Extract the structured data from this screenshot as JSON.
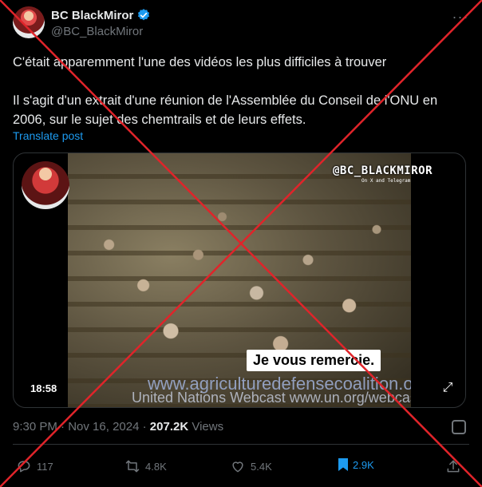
{
  "author": {
    "name": "BC BlackMiror",
    "handle": "@BC_BlackMiror",
    "verified_icon": "verified-badge-icon"
  },
  "more_icon": "more-options-icon",
  "tweet": {
    "line1": "C'était apparemment l'une des vidéos les plus difficiles à trouver",
    "line2": "Il s'agit d'un extrait d'une réunion de l'Assemblée du Conseil de l'ONU en 2006, sur le sujet des chemtrails et de leurs effets.",
    "translate_label": "Translate post"
  },
  "media": {
    "watermark": "@BC_BLACKMIROR",
    "watermark_sub": "On X and Telegram",
    "subtitle": "Je vous remercie.",
    "url_text": "www.agriculturedefensecoalition.org",
    "webcast_text": "United Nations Webcast www.un.org/webcast",
    "duration": "18:58",
    "expand_icon": "expand-icon"
  },
  "meta": {
    "time": "9:30 PM",
    "date": "Nov 16, 2024",
    "separator1": "·",
    "separator2": "·",
    "views": "207.2K",
    "views_label": "Views"
  },
  "actions": {
    "replies": "117",
    "reposts": "4.8K",
    "likes": "5.4K",
    "bookmarks": "2.9K"
  },
  "colors": {
    "accent": "#1d9bf0",
    "cross": "#e0242a",
    "background": "#000000",
    "muted": "#71767b"
  }
}
